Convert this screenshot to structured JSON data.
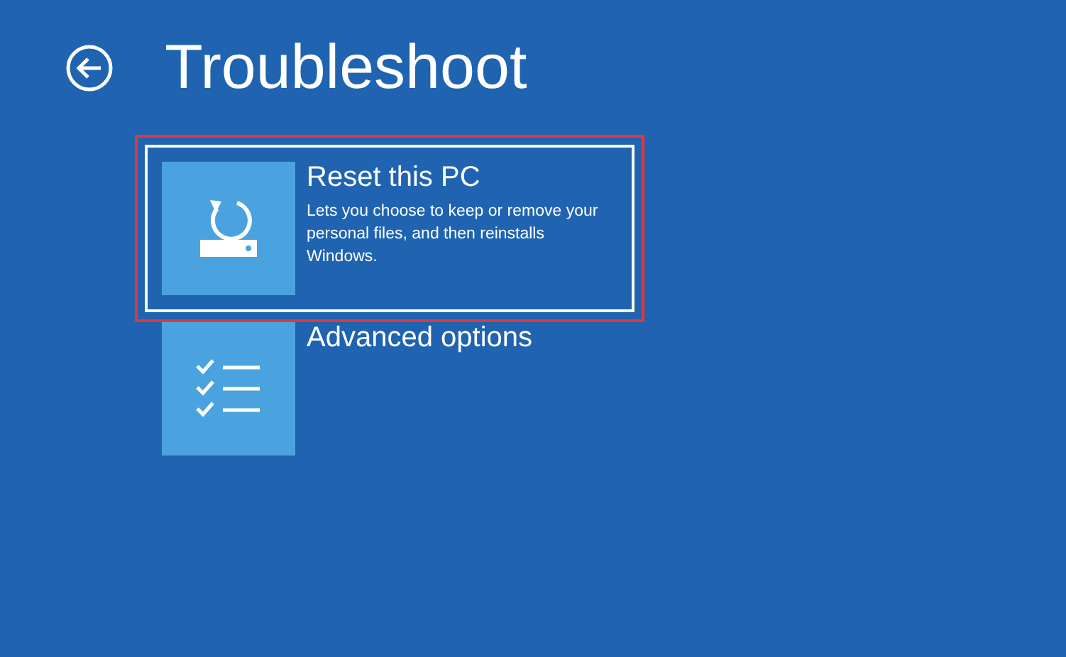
{
  "header": {
    "title": "Troubleshoot"
  },
  "options": [
    {
      "kind": "reset",
      "title": "Reset this PC",
      "description": "Lets you choose to keep or remove your personal files, and then reinstalls Windows.",
      "selected": true,
      "annotated": true
    },
    {
      "kind": "advanced",
      "title": "Advanced options",
      "selected": false,
      "annotated": false
    }
  ]
}
